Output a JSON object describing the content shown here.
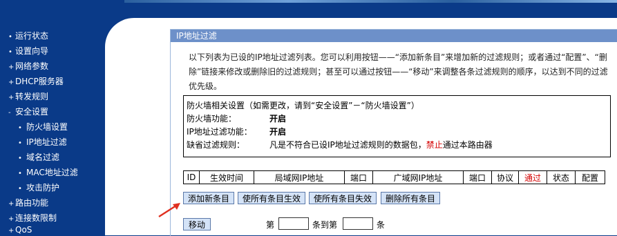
{
  "sidebar": {
    "items": [
      {
        "label": "运行状态",
        "level": 0
      },
      {
        "label": "设置向导",
        "level": 0
      },
      {
        "label": "网络参数",
        "level": 0,
        "marker": "+"
      },
      {
        "label": "DHCP服务器",
        "level": 0,
        "marker": "+"
      },
      {
        "label": "转发规则",
        "level": 0,
        "marker": "+"
      },
      {
        "label": "安全设置",
        "level": 0,
        "marker": "-"
      },
      {
        "label": "防火墙设置",
        "level": 1
      },
      {
        "label": "IP地址过滤",
        "level": 1
      },
      {
        "label": "域名过滤",
        "level": 1
      },
      {
        "label": "MAC地址过滤",
        "level": 1
      },
      {
        "label": "攻击防护",
        "level": 1
      },
      {
        "label": "路由功能",
        "level": 0,
        "marker": "+"
      },
      {
        "label": "连接数限制",
        "level": 0,
        "marker": "+"
      },
      {
        "label": "QoS",
        "level": 0,
        "marker": "+"
      }
    ]
  },
  "panel": {
    "title": "IP地址过滤",
    "description": "以下列表为已设的IP地址过滤列表。您可以利用按钮——“添加新条目”来增加新的过滤规则；或者通过“配置”、“删除”链接来修改或删除旧的过滤规则；甚至可以通过按钮——“移动”来调整各条过滤规则的顺序，以达到不同的过滤优先级。"
  },
  "firewall": {
    "heading": "防火墙相关设置（如需更改，请到“安全设置”－“防火墙设置”）",
    "firewall_label": "防火墙功能：",
    "firewall_value": "开启",
    "ipfilter_label": "IP地址过滤功能：",
    "ipfilter_value": "开启",
    "default_label": "缺省过滤规则：",
    "default_value_pre": "凡是不符合已设IP地址过滤规则的数据包，",
    "default_value_red": "禁止",
    "default_value_post": "通过本路由器"
  },
  "table": {
    "headers": [
      "ID",
      "生效时间",
      "局域网IP地址",
      "端口",
      "广域网IP地址",
      "端口",
      "协议",
      "通过",
      "状态",
      "配置"
    ]
  },
  "buttons": {
    "add": "添加新条目",
    "enable_all": "使所有条目生效",
    "disable_all": "使所有条目失效",
    "delete_all": "删除所有条目",
    "move": "移动"
  },
  "move": {
    "from_label": "第",
    "to_label": "条到第",
    "suffix": "条",
    "from_value": "",
    "to_value": ""
  },
  "colors": {
    "background": "#0a3a88",
    "panel_title": "#6d90c9",
    "button": "#d4e3f7",
    "highlight": "#d40000",
    "annotation_arrow": "#e03020"
  }
}
